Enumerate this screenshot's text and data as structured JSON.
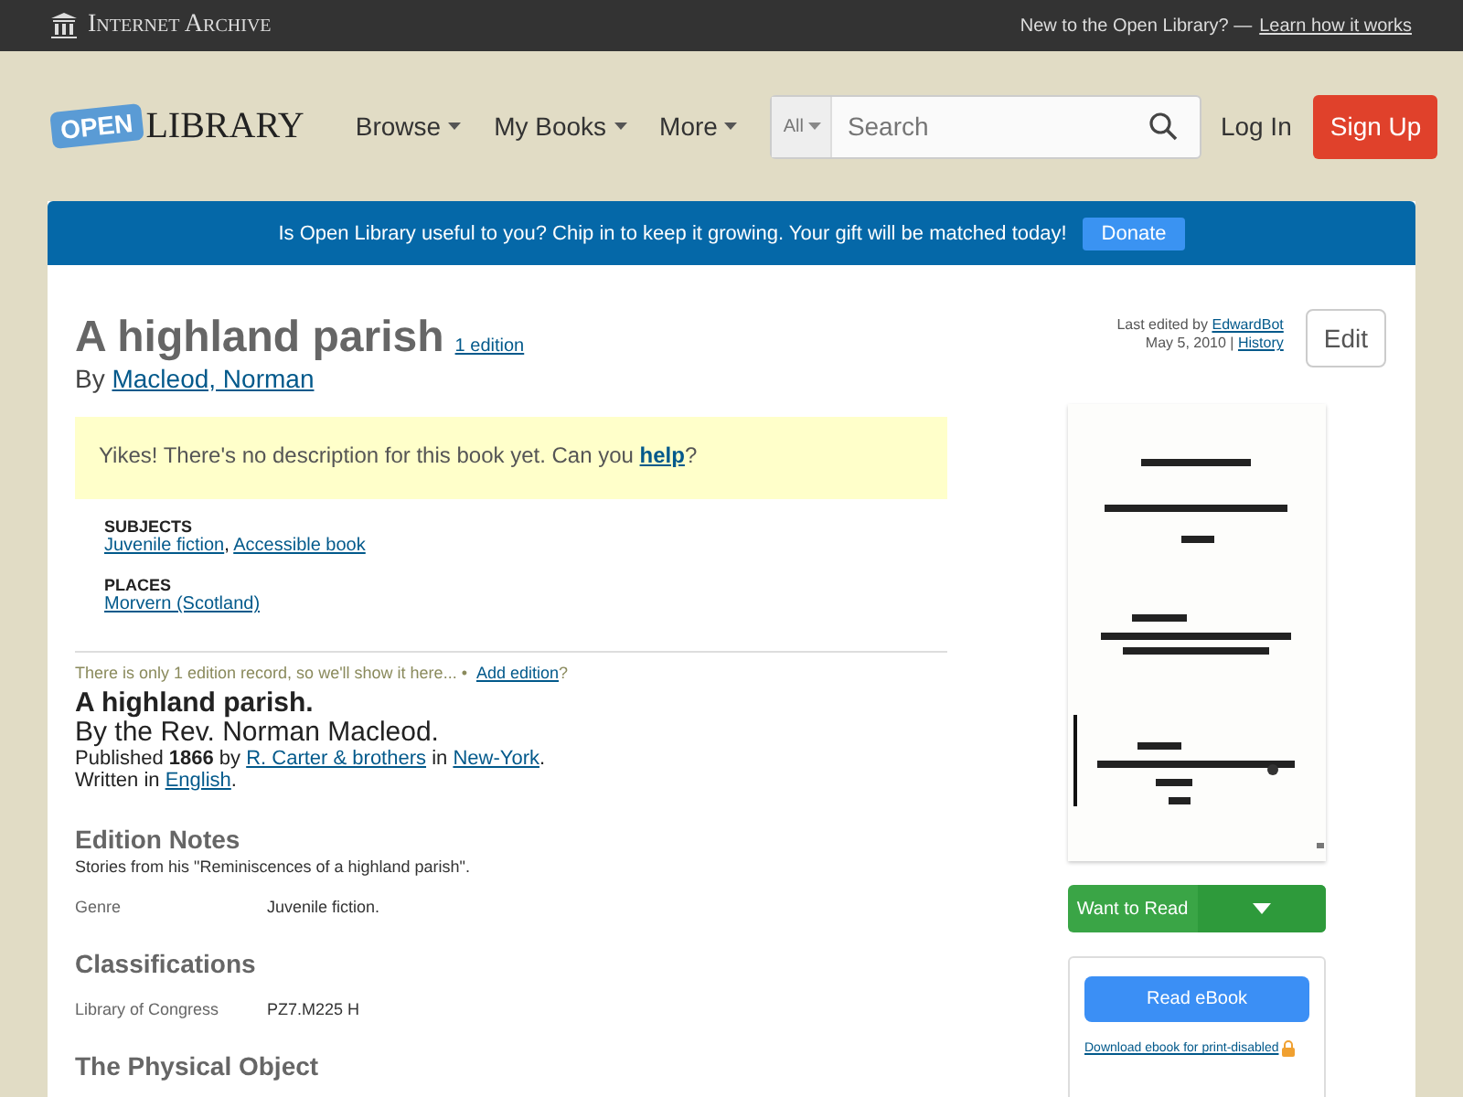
{
  "top_bar": {
    "brand": "Internet Archive",
    "prompt": "New to the Open Library? —",
    "link": "Learn how it works"
  },
  "header": {
    "logo_badge": "OPEN",
    "logo_text": "LIBRARY",
    "nav": [
      "Browse",
      "My Books",
      "More"
    ],
    "search": {
      "scope": "All",
      "placeholder": "Search"
    },
    "login": "Log In",
    "signup": "Sign Up"
  },
  "banner": {
    "text": "Is Open Library useful to you? Chip in to keep it growing. Your gift will be matched today!",
    "button": "Donate"
  },
  "work": {
    "title": "A highland parish",
    "editions_link": "1 edition",
    "by": "By",
    "author": "Macleod, Norman",
    "edited": {
      "label": "Last edited by",
      "user": "EdwardBot",
      "date": "May 5, 2010 |",
      "history": "History"
    },
    "edit_button": "Edit",
    "description": [
      {
        "kind": "text",
        "text": "Yikes! There's no description for this book yet. Can you "
      },
      {
        "kind": "link",
        "text": "help"
      },
      {
        "kind": "text",
        "text": "?"
      }
    ],
    "subjects": {
      "heading": "SUBJECTS",
      "separator": ",",
      "links": [
        "Juvenile fiction",
        "Accessible book"
      ]
    },
    "places": {
      "heading": "PLACES",
      "links": [
        "Morvern (Scotland)"
      ]
    }
  },
  "edition": {
    "notice": "There is only 1 edition record, so we'll show it here...  •",
    "add_link": "Add edition",
    "add_suffix": "?",
    "title": "A highland parish.",
    "byline": "By the Rev. Norman Macleod.",
    "published": [
      {
        "kind": "text",
        "text": "Published "
      },
      {
        "kind": "bold",
        "text": "1866"
      },
      {
        "kind": "text",
        "text": " by "
      },
      {
        "kind": "link",
        "text": "R. Carter & brothers"
      },
      {
        "kind": "text",
        "text": " in "
      },
      {
        "kind": "link",
        "text": "New-York"
      },
      {
        "kind": "text",
        "text": "."
      }
    ],
    "language": [
      {
        "kind": "text",
        "text": "Written in "
      },
      {
        "kind": "link",
        "text": "English"
      },
      {
        "kind": "text",
        "text": "."
      }
    ]
  },
  "sections": [
    {
      "heading": "Edition Notes",
      "note": "Stories from his \"Reminiscences of a highland parish\".",
      "fields": [
        {
          "label": "Genre",
          "value": "Juvenile fiction."
        }
      ]
    },
    {
      "heading": "Classifications",
      "fields": [
        {
          "label": "Library of Congress",
          "value": "PZ7.M225 H"
        }
      ]
    },
    {
      "heading": "The Physical Object"
    }
  ],
  "sidebar": {
    "want_button": "Want to Read",
    "read_button": "Read eBook",
    "download_link": "Download ebook for print-disabled"
  }
}
